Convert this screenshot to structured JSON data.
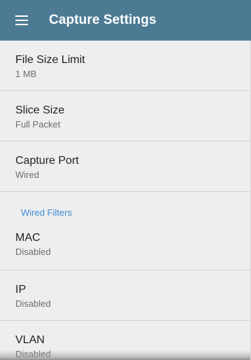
{
  "appbar": {
    "menu_icon": "menu-icon",
    "title": "Capture Settings",
    "color": "#4c7a93"
  },
  "settings": {
    "file_size_limit": {
      "title": "File Size Limit",
      "value": "1  MB"
    },
    "slice_size": {
      "title": "Slice Size",
      "value": "Full Packet"
    },
    "capture_port": {
      "title": "Capture Port",
      "value": "Wired"
    }
  },
  "wired_filters": {
    "header": "Wired Filters",
    "header_color": "#3f8fd6",
    "items": [
      {
        "title": "MAC",
        "value": "Disabled"
      },
      {
        "title": "IP",
        "value": "Disabled"
      },
      {
        "title": "VLAN",
        "value": "Disabled"
      }
    ]
  }
}
